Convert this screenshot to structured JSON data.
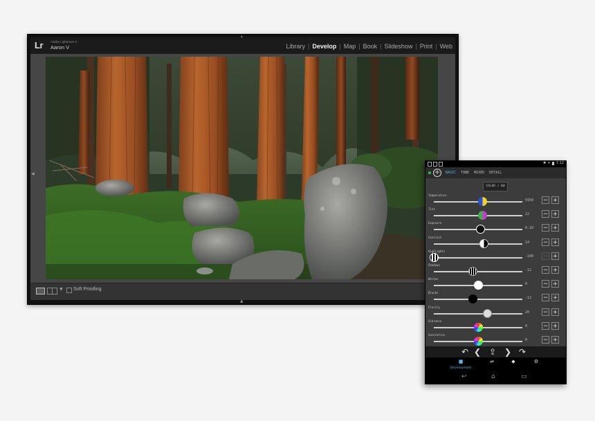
{
  "lightroom": {
    "logo": "Lr",
    "product": "Adobe Lightroom 6",
    "user": "Aaron V",
    "modules": [
      {
        "label": "Library",
        "active": false
      },
      {
        "label": "Develop",
        "active": true
      },
      {
        "label": "Map",
        "active": false
      },
      {
        "label": "Book",
        "active": false
      },
      {
        "label": "Slideshow",
        "active": false
      },
      {
        "label": "Print",
        "active": false
      },
      {
        "label": "Web",
        "active": false
      }
    ],
    "separator": "|",
    "toolbar": {
      "soft_proofing": "Soft Proofing"
    }
  },
  "tablet": {
    "status": {
      "time": "7:12"
    },
    "tabs": [
      {
        "label": "BASIC",
        "active": true
      },
      {
        "label": "TONE",
        "active": false
      },
      {
        "label": "MIXER",
        "active": false
      },
      {
        "label": "DETAIL",
        "active": false
      }
    ],
    "color_bw_label": "COLOR / BW",
    "sliders": [
      {
        "label": "Temperature",
        "value": "5950",
        "pos": 0.55,
        "knob": "temp"
      },
      {
        "label": "Tint",
        "value": "12",
        "pos": 0.55,
        "knob": "tint"
      },
      {
        "label": "Exposure",
        "value": "0.10",
        "pos": 0.52,
        "knob": "exposure"
      },
      {
        "label": "Contrast",
        "value": "14",
        "pos": 0.56,
        "knob": "contrast"
      },
      {
        "label": "Highlights",
        "value": "-100",
        "pos": 0.0,
        "knob": "highlights"
      },
      {
        "label": "Shadows",
        "value": "-12",
        "pos": 0.44,
        "knob": "shadows"
      },
      {
        "label": "Whites",
        "value": "0",
        "pos": 0.5,
        "knob": "whites"
      },
      {
        "label": "Blacks",
        "value": "-12",
        "pos": 0.44,
        "knob": "blacks"
      },
      {
        "label": "Clarity",
        "value": "20",
        "pos": 0.6,
        "knob": "clarity"
      },
      {
        "label": "Vibrance",
        "value": "0",
        "pos": 0.5,
        "knob": "vibrance"
      },
      {
        "label": "Saturation",
        "value": "0",
        "pos": 0.5,
        "knob": "saturation"
      }
    ],
    "step_minus": "−",
    "step_plus": "+",
    "nav": [
      {
        "label": "Development",
        "icon": "camera-icon",
        "active": true
      },
      {
        "label": "",
        "icon": "sliders-icon",
        "active": false
      },
      {
        "label": "",
        "icon": "cube-icon",
        "active": false
      },
      {
        "label": "",
        "icon": "gear-icon",
        "active": false
      }
    ]
  },
  "colors": {
    "accent": "#56b7ec",
    "connected": "#37c03a",
    "lr_background": "#464646"
  }
}
